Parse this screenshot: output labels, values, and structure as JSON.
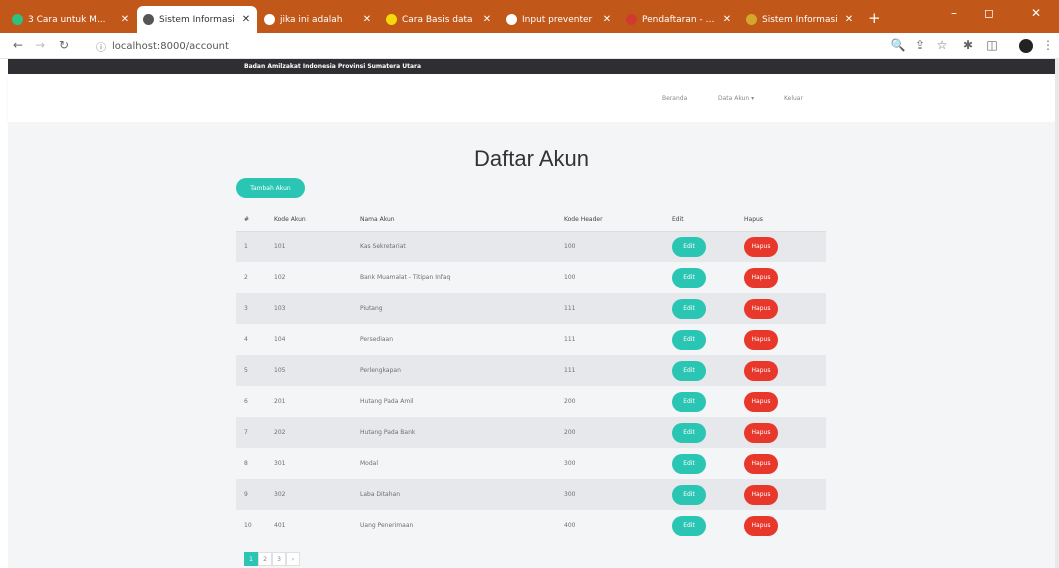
{
  "browser": {
    "tabs": [
      {
        "label": "3 Cara untuk M...",
        "favicon": "#2ec27e",
        "active": false
      },
      {
        "label": "Sistem Informasi",
        "favicon": "#555555",
        "active": true
      },
      {
        "label": "jika ini adalah",
        "favicon": "#ffffff",
        "active": false
      },
      {
        "label": "Cara Basis data",
        "favicon": "#f5d90a",
        "active": false
      },
      {
        "label": "Input preventer",
        "favicon": "#ffffff",
        "active": false
      },
      {
        "label": "Pendaftaran - W...",
        "favicon": "#d03b2f",
        "active": false
      },
      {
        "label": "Sistem Informasi",
        "favicon": "#d4a72c",
        "active": false
      }
    ],
    "url": "localhost:8000/account",
    "new_tab": "+",
    "win_minimize": "–",
    "win_maximize": "◻",
    "win_close": "✕"
  },
  "header": {
    "org_name": "Badan Amilzakat Indonesia Provinsi Sumatera Utara",
    "nav": {
      "home": "Beranda",
      "data_akun": "Data Akun ▾",
      "logout": "Keluar"
    }
  },
  "page": {
    "title": "Daftar Akun",
    "add_button": "Tambah Akun"
  },
  "table": {
    "headers": [
      "#",
      "Kode Akun",
      "Nama Akun",
      "Kode Header",
      "Edit",
      "Hapus"
    ],
    "edit_label": "Edit",
    "delete_label": "Hapus",
    "rows": [
      {
        "no": "1",
        "kode": "101",
        "nama": "Kas Sekretariat",
        "header": "100"
      },
      {
        "no": "2",
        "kode": "102",
        "nama": "Bank Muamalat - Titipan Infaq",
        "header": "100"
      },
      {
        "no": "3",
        "kode": "103",
        "nama": "Piutang",
        "header": "111"
      },
      {
        "no": "4",
        "kode": "104",
        "nama": "Persediaan",
        "header": "111"
      },
      {
        "no": "5",
        "kode": "105",
        "nama": "Perlengkapan",
        "header": "111"
      },
      {
        "no": "6",
        "kode": "201",
        "nama": "Hutang Pada Amil",
        "header": "200"
      },
      {
        "no": "7",
        "kode": "202",
        "nama": "Hutang Pada Bank",
        "header": "200"
      },
      {
        "no": "8",
        "kode": "301",
        "nama": "Modal",
        "header": "300"
      },
      {
        "no": "9",
        "kode": "302",
        "nama": "Laba Ditahan",
        "header": "300"
      },
      {
        "no": "10",
        "kode": "401",
        "nama": "Uang Penerimaan",
        "header": "400"
      }
    ]
  },
  "pagination": {
    "pages": [
      "1",
      "2",
      "3",
      "›"
    ]
  }
}
